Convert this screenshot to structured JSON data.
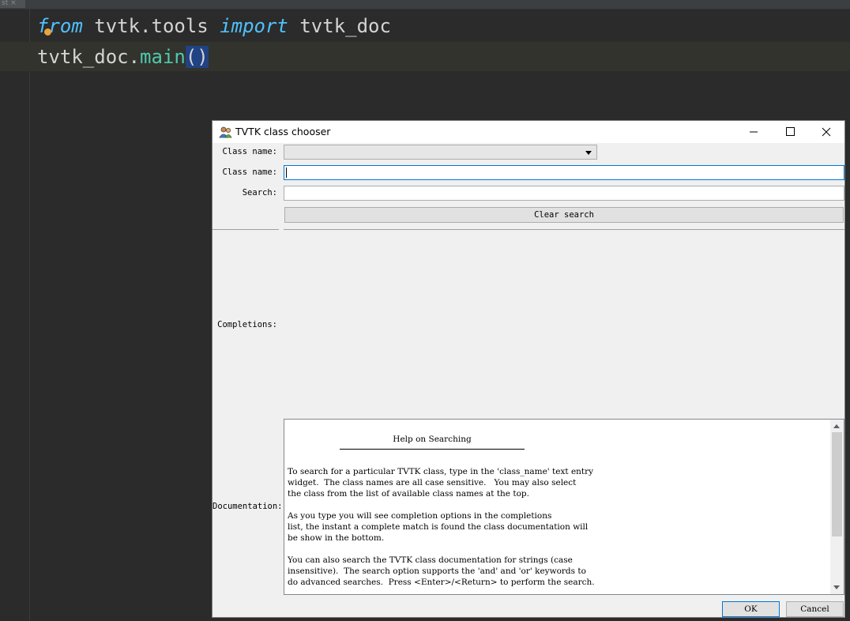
{
  "editor": {
    "tab_fragment": "st ×",
    "line1": {
      "kw_from": "from",
      "module": " tvtk.tools ",
      "kw_import": "import",
      "name": " tvtk_doc"
    },
    "line2": {
      "obj": "tvtk_doc.",
      "method": "main",
      "parens": "()"
    }
  },
  "dialog": {
    "title": "TVTK class chooser",
    "labels": {
      "class_name_1": "Class name:",
      "class_name_2": "Class name:",
      "search": "Search:",
      "completions": "Completions:",
      "documentation": "Documentation:"
    },
    "class_combo_value": "",
    "class_name_value": "",
    "search_value": "",
    "clear_search": "Clear search",
    "doc_heading": "Help on Searching",
    "doc_body": "To search for a particular TVTK class, type in the 'class_name' text entry\nwidget.  The class names are all case sensitive.   You may also select\nthe class from the list of available class names at the top.\n\nAs you type you will see completion options in the completions\nlist, the instant a complete match is found the class documentation will\nbe show in the bottom.\n\nYou can also search the TVTK class documentation for strings (case\ninsensitive).  The search option supports the 'and' and 'or' keywords to\ndo advanced searches.  Press <Enter>/<Return> to perform the search.",
    "ok": "OK",
    "cancel": "Cancel"
  }
}
